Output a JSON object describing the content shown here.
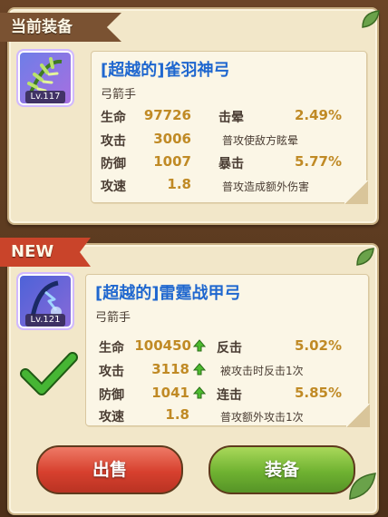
{
  "current": {
    "ribbon": "当前装备",
    "item": {
      "name": "[超越的]雀羽神弓",
      "class": "弓箭手",
      "level": "Lv.117",
      "stats": [
        {
          "label": "生命",
          "value": "97726"
        },
        {
          "label": "攻击",
          "value": "3006"
        },
        {
          "label": "防御",
          "value": "1007"
        },
        {
          "label": "攻速",
          "value": "1.8"
        }
      ],
      "effects": [
        {
          "label": "击晕",
          "value": "2.49%",
          "desc": "普攻使敌方眩晕"
        },
        {
          "label": "暴击",
          "value": "5.77%",
          "desc": "普攻造成额外伤害"
        }
      ]
    }
  },
  "new": {
    "ribbon": "NEW",
    "item": {
      "name": "[超越的]雷霆战甲弓",
      "class": "弓箭手",
      "level": "Lv.121",
      "stats": [
        {
          "label": "生命",
          "value": "100450",
          "up": true
        },
        {
          "label": "攻击",
          "value": "3118",
          "up": true
        },
        {
          "label": "防御",
          "value": "1041",
          "up": true
        },
        {
          "label": "攻速",
          "value": "1.8",
          "up": false
        }
      ],
      "effects": [
        {
          "label": "反击",
          "value": "5.02%",
          "desc": "被攻击时反击1次"
        },
        {
          "label": "连击",
          "value": "5.85%",
          "desc": "普攻额外攻击1次"
        }
      ]
    }
  },
  "buttons": {
    "sell": "出售",
    "equip": "装备"
  },
  "colors": {
    "name": "#1f67cf",
    "value": "#c08a25",
    "sell": "#d7402e",
    "equip": "#6fb231",
    "check": "#3aa22a"
  },
  "icons": [
    "feather-bow-icon",
    "thunder-bow-icon",
    "green-arrow-up-icon",
    "checkmark-icon",
    "leaf-icon"
  ]
}
